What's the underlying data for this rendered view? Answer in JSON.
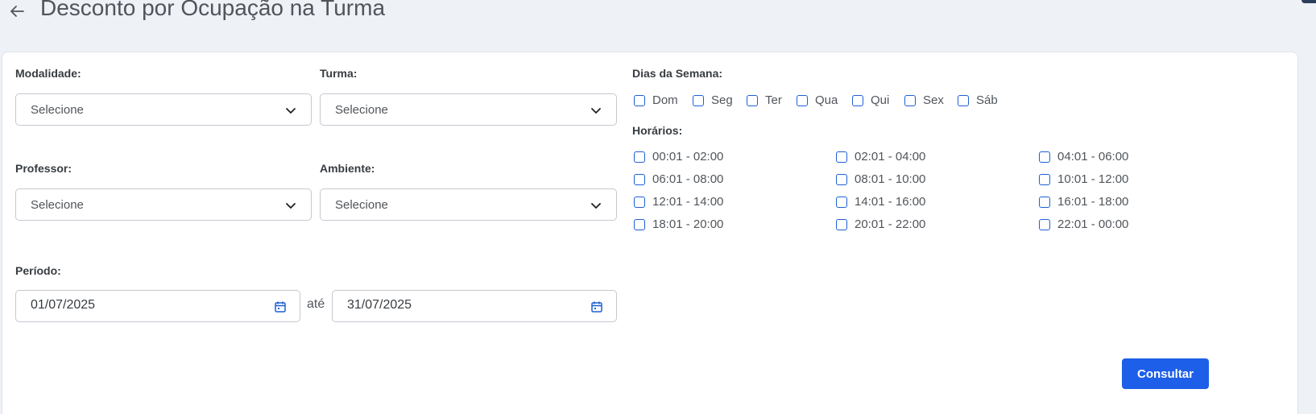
{
  "header": {
    "title": "Desconto por Ocupação na Turma",
    "back_icon": "arrow-left-icon"
  },
  "form": {
    "modalidade": {
      "label": "Modalidade:",
      "value": "Selecione"
    },
    "turma": {
      "label": "Turma:",
      "value": "Selecione"
    },
    "professor": {
      "label": "Professor:",
      "value": "Selecione"
    },
    "ambiente": {
      "label": "Ambiente:",
      "value": "Selecione"
    },
    "periodo": {
      "label": "Período:",
      "start": "01/07/2025",
      "separator": "até",
      "end": "31/07/2025"
    },
    "dias": {
      "label": "Dias da Semana:",
      "items": [
        "Dom",
        "Seg",
        "Ter",
        "Qua",
        "Qui",
        "Sex",
        "Sáb"
      ]
    },
    "horarios": {
      "label": "Horários:",
      "items": [
        "00:01 - 02:00",
        "02:01 - 04:00",
        "04:01 - 06:00",
        "06:01 - 08:00",
        "08:01 - 10:00",
        "10:01 - 12:00",
        "12:01 - 14:00",
        "14:01 - 16:00",
        "16:01 - 18:00",
        "18:01 - 20:00",
        "20:01 - 22:00",
        "22:01 - 00:00"
      ]
    },
    "submit_label": "Consultar"
  },
  "colors": {
    "accent": "#1d5fe8",
    "checkbox_border": "#1d5fd6",
    "background": "#eef1f6"
  }
}
